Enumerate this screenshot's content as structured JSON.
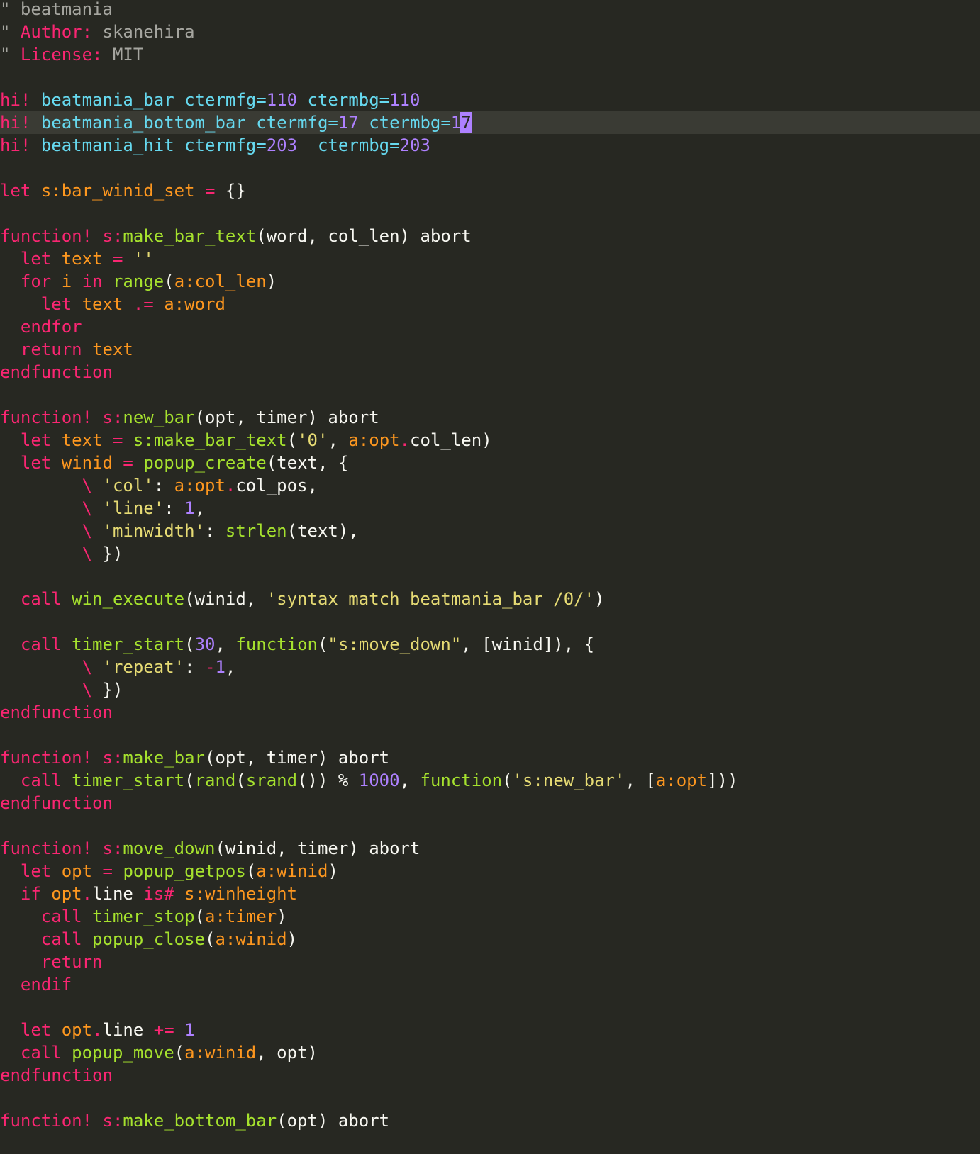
{
  "editor": {
    "name": "vim",
    "colors": {
      "background": "#272822",
      "cursorline": "#3a3b34",
      "comment": "#a6a6a0",
      "keyword": "#f92672",
      "function": "#a6e22e",
      "string": "#e6db74",
      "number": "#ae81ff",
      "type": "#66d9ef",
      "variable": "#fd971f",
      "text": "#f8f8f2"
    },
    "cursor": {
      "line_index": 5,
      "token_index": 6
    },
    "lines": [
      [
        [
          "comment",
          "\" beatmania"
        ]
      ],
      [
        [
          "comment",
          "\" "
        ],
        [
          "special",
          "Author:"
        ],
        [
          "comment",
          " skanehira"
        ]
      ],
      [
        [
          "comment",
          "\" "
        ],
        [
          "special",
          "License:"
        ],
        [
          "comment",
          " MIT"
        ]
      ],
      [],
      [
        [
          "keyword",
          "hi!"
        ],
        [
          "plain",
          " "
        ],
        [
          "group",
          "beatmania_bar"
        ],
        [
          "plain",
          " "
        ],
        [
          "attr",
          "ctermfg="
        ],
        [
          "number",
          "110"
        ],
        [
          "plain",
          " "
        ],
        [
          "attr",
          "ctermbg="
        ],
        [
          "number",
          "110"
        ]
      ],
      [
        [
          "keyword",
          "hi!"
        ],
        [
          "plain",
          " "
        ],
        [
          "group",
          "beatmania_bottom_bar"
        ],
        [
          "plain",
          " "
        ],
        [
          "attr",
          "ctermfg="
        ],
        [
          "number",
          "17"
        ],
        [
          "attr",
          " ctermbg="
        ],
        [
          "number",
          "1"
        ],
        [
          "cursor",
          "7"
        ]
      ],
      [
        [
          "keyword",
          "hi!"
        ],
        [
          "plain",
          " "
        ],
        [
          "group",
          "beatmania_hit"
        ],
        [
          "plain",
          " "
        ],
        [
          "attr",
          "ctermfg="
        ],
        [
          "number",
          "203"
        ],
        [
          "plain",
          "  "
        ],
        [
          "attr",
          "ctermbg="
        ],
        [
          "number",
          "203"
        ]
      ],
      [],
      [
        [
          "keyword",
          "let"
        ],
        [
          "plain",
          " "
        ],
        [
          "var",
          "s:bar_winid_set"
        ],
        [
          "plain",
          " "
        ],
        [
          "keyword",
          "="
        ],
        [
          "plain",
          " {}"
        ]
      ],
      [],
      [
        [
          "keyword",
          "function!"
        ],
        [
          "plain",
          " "
        ],
        [
          "scope",
          "s:"
        ],
        [
          "func",
          "make_bar_text"
        ],
        [
          "plain",
          "(word, col_len) abort"
        ]
      ],
      [
        [
          "plain",
          "  "
        ],
        [
          "keyword",
          "let"
        ],
        [
          "plain",
          " "
        ],
        [
          "var",
          "text"
        ],
        [
          "plain",
          " "
        ],
        [
          "keyword",
          "="
        ],
        [
          "plain",
          " "
        ],
        [
          "string",
          "''"
        ]
      ],
      [
        [
          "plain",
          "  "
        ],
        [
          "keyword",
          "for"
        ],
        [
          "plain",
          " "
        ],
        [
          "var",
          "i"
        ],
        [
          "plain",
          " "
        ],
        [
          "keyword",
          "in"
        ],
        [
          "plain",
          " "
        ],
        [
          "func",
          "range"
        ],
        [
          "plain",
          "("
        ],
        [
          "var",
          "a:col_len"
        ],
        [
          "plain",
          ")"
        ]
      ],
      [
        [
          "plain",
          "    "
        ],
        [
          "keyword",
          "let"
        ],
        [
          "plain",
          " "
        ],
        [
          "var",
          "text"
        ],
        [
          "plain",
          " "
        ],
        [
          "keyword",
          ".="
        ],
        [
          "plain",
          " "
        ],
        [
          "var",
          "a:word"
        ]
      ],
      [
        [
          "plain",
          "  "
        ],
        [
          "keyword",
          "endfor"
        ]
      ],
      [
        [
          "plain",
          "  "
        ],
        [
          "keyword",
          "return"
        ],
        [
          "plain",
          " "
        ],
        [
          "var",
          "text"
        ]
      ],
      [
        [
          "keyword",
          "endfunction"
        ]
      ],
      [],
      [
        [
          "keyword",
          "function!"
        ],
        [
          "plain",
          " "
        ],
        [
          "scope",
          "s:"
        ],
        [
          "func",
          "new_bar"
        ],
        [
          "plain",
          "(opt, timer) abort"
        ]
      ],
      [
        [
          "plain",
          "  "
        ],
        [
          "keyword",
          "let"
        ],
        [
          "plain",
          " "
        ],
        [
          "var",
          "text"
        ],
        [
          "plain",
          " "
        ],
        [
          "keyword",
          "="
        ],
        [
          "plain",
          " "
        ],
        [
          "func",
          "s:make_bar_text"
        ],
        [
          "plain",
          "("
        ],
        [
          "string",
          "'0'"
        ],
        [
          "plain",
          ", "
        ],
        [
          "var",
          "a:opt"
        ],
        [
          "keyword",
          "."
        ],
        [
          "plain",
          "col_len)"
        ]
      ],
      [
        [
          "plain",
          "  "
        ],
        [
          "keyword",
          "let"
        ],
        [
          "plain",
          " "
        ],
        [
          "var",
          "winid"
        ],
        [
          "plain",
          " "
        ],
        [
          "keyword",
          "="
        ],
        [
          "plain",
          " "
        ],
        [
          "func",
          "popup_create"
        ],
        [
          "plain",
          "(text, {"
        ]
      ],
      [
        [
          "plain",
          "        "
        ],
        [
          "special",
          "\\"
        ],
        [
          "plain",
          " "
        ],
        [
          "string",
          "'col'"
        ],
        [
          "plain",
          ": "
        ],
        [
          "var",
          "a:opt"
        ],
        [
          "keyword",
          "."
        ],
        [
          "plain",
          "col_pos,"
        ]
      ],
      [
        [
          "plain",
          "        "
        ],
        [
          "special",
          "\\"
        ],
        [
          "plain",
          " "
        ],
        [
          "string",
          "'line'"
        ],
        [
          "plain",
          ": "
        ],
        [
          "number",
          "1"
        ],
        [
          "plain",
          ","
        ]
      ],
      [
        [
          "plain",
          "        "
        ],
        [
          "special",
          "\\"
        ],
        [
          "plain",
          " "
        ],
        [
          "string",
          "'minwidth'"
        ],
        [
          "plain",
          ": "
        ],
        [
          "func",
          "strlen"
        ],
        [
          "plain",
          "(text),"
        ]
      ],
      [
        [
          "plain",
          "        "
        ],
        [
          "special",
          "\\"
        ],
        [
          "plain",
          " })"
        ]
      ],
      [],
      [
        [
          "plain",
          "  "
        ],
        [
          "keyword",
          "call"
        ],
        [
          "plain",
          " "
        ],
        [
          "func",
          "win_execute"
        ],
        [
          "plain",
          "(winid, "
        ],
        [
          "string",
          "'syntax match beatmania_bar /0/'"
        ],
        [
          "plain",
          ")"
        ]
      ],
      [],
      [
        [
          "plain",
          "  "
        ],
        [
          "keyword",
          "call"
        ],
        [
          "plain",
          " "
        ],
        [
          "func",
          "timer_start"
        ],
        [
          "plain",
          "("
        ],
        [
          "number",
          "30"
        ],
        [
          "plain",
          ", "
        ],
        [
          "func",
          "function"
        ],
        [
          "plain",
          "("
        ],
        [
          "string",
          "\"s:move_down\""
        ],
        [
          "plain",
          ", [winid]), {"
        ]
      ],
      [
        [
          "plain",
          "        "
        ],
        [
          "special",
          "\\"
        ],
        [
          "plain",
          " "
        ],
        [
          "string",
          "'repeat'"
        ],
        [
          "plain",
          ": "
        ],
        [
          "keyword",
          "-"
        ],
        [
          "number",
          "1"
        ],
        [
          "plain",
          ","
        ]
      ],
      [
        [
          "plain",
          "        "
        ],
        [
          "special",
          "\\"
        ],
        [
          "plain",
          " })"
        ]
      ],
      [
        [
          "keyword",
          "endfunction"
        ]
      ],
      [],
      [
        [
          "keyword",
          "function!"
        ],
        [
          "plain",
          " "
        ],
        [
          "scope",
          "s:"
        ],
        [
          "func",
          "make_bar"
        ],
        [
          "plain",
          "(opt, timer) abort"
        ]
      ],
      [
        [
          "plain",
          "  "
        ],
        [
          "keyword",
          "call"
        ],
        [
          "plain",
          " "
        ],
        [
          "func",
          "timer_start"
        ],
        [
          "plain",
          "("
        ],
        [
          "func",
          "rand"
        ],
        [
          "plain",
          "("
        ],
        [
          "func",
          "srand"
        ],
        [
          "plain",
          "()) % "
        ],
        [
          "number",
          "1000"
        ],
        [
          "plain",
          ", "
        ],
        [
          "func",
          "function"
        ],
        [
          "plain",
          "("
        ],
        [
          "string",
          "'s:new_bar'"
        ],
        [
          "plain",
          ", ["
        ],
        [
          "var",
          "a:opt"
        ],
        [
          "plain",
          "]))"
        ]
      ],
      [
        [
          "keyword",
          "endfunction"
        ]
      ],
      [],
      [
        [
          "keyword",
          "function!"
        ],
        [
          "plain",
          " "
        ],
        [
          "scope",
          "s:"
        ],
        [
          "func",
          "move_down"
        ],
        [
          "plain",
          "(winid, timer) abort"
        ]
      ],
      [
        [
          "plain",
          "  "
        ],
        [
          "keyword",
          "let"
        ],
        [
          "plain",
          " "
        ],
        [
          "var",
          "opt"
        ],
        [
          "plain",
          " "
        ],
        [
          "keyword",
          "="
        ],
        [
          "plain",
          " "
        ],
        [
          "func",
          "popup_getpos"
        ],
        [
          "plain",
          "("
        ],
        [
          "var",
          "a:winid"
        ],
        [
          "plain",
          ")"
        ]
      ],
      [
        [
          "plain",
          "  "
        ],
        [
          "keyword",
          "if"
        ],
        [
          "plain",
          " "
        ],
        [
          "var",
          "opt"
        ],
        [
          "keyword",
          "."
        ],
        [
          "plain",
          "line "
        ],
        [
          "keyword",
          "is#"
        ],
        [
          "plain",
          " "
        ],
        [
          "var",
          "s:winheight"
        ]
      ],
      [
        [
          "plain",
          "    "
        ],
        [
          "keyword",
          "call"
        ],
        [
          "plain",
          " "
        ],
        [
          "func",
          "timer_stop"
        ],
        [
          "plain",
          "("
        ],
        [
          "var",
          "a:timer"
        ],
        [
          "plain",
          ")"
        ]
      ],
      [
        [
          "plain",
          "    "
        ],
        [
          "keyword",
          "call"
        ],
        [
          "plain",
          " "
        ],
        [
          "func",
          "popup_close"
        ],
        [
          "plain",
          "("
        ],
        [
          "var",
          "a:winid"
        ],
        [
          "plain",
          ")"
        ]
      ],
      [
        [
          "plain",
          "    "
        ],
        [
          "keyword",
          "return"
        ]
      ],
      [
        [
          "plain",
          "  "
        ],
        [
          "keyword",
          "endif"
        ]
      ],
      [],
      [
        [
          "plain",
          "  "
        ],
        [
          "keyword",
          "let"
        ],
        [
          "plain",
          " "
        ],
        [
          "var",
          "opt"
        ],
        [
          "keyword",
          "."
        ],
        [
          "plain",
          "line "
        ],
        [
          "keyword",
          "+="
        ],
        [
          "plain",
          " "
        ],
        [
          "number",
          "1"
        ]
      ],
      [
        [
          "plain",
          "  "
        ],
        [
          "keyword",
          "call"
        ],
        [
          "plain",
          " "
        ],
        [
          "func",
          "popup_move"
        ],
        [
          "plain",
          "("
        ],
        [
          "var",
          "a:winid"
        ],
        [
          "plain",
          ", opt)"
        ]
      ],
      [
        [
          "keyword",
          "endfunction"
        ]
      ],
      [],
      [
        [
          "keyword",
          "function!"
        ],
        [
          "plain",
          " "
        ],
        [
          "scope",
          "s:"
        ],
        [
          "func",
          "make_bottom_bar"
        ],
        [
          "plain",
          "(opt) abort"
        ]
      ]
    ]
  }
}
